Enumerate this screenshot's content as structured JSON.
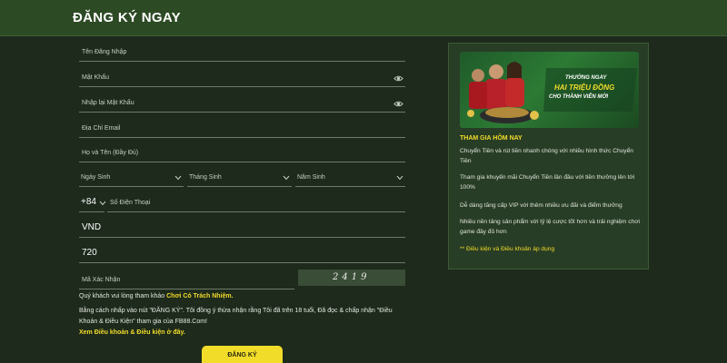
{
  "header": {
    "title": "ĐĂNG KÝ NGAY"
  },
  "form": {
    "username_placeholder": "Tên Đăng Nhập",
    "password_placeholder": "Mật Khẩu",
    "confirm_password_placeholder": "Nhập lại Mật Khẩu",
    "email_placeholder": "Địa Chỉ Email",
    "fullname_placeholder": "Họ và Tên (Đầy Đủ)",
    "birth_day_placeholder": "Ngày Sinh",
    "birth_month_placeholder": "Tháng Sinh",
    "birth_year_placeholder": "Năm Sinh",
    "country_code": "+84",
    "phone_placeholder": "Số Điện Thoại",
    "currency_value": "VND",
    "code_value": "720",
    "captcha_placeholder": "Mã Xác Nhận",
    "captcha_code": "2419",
    "note_prefix": "Quý khách vui lòng tham khảo",
    "note_link": "Chơi Có Trách Nhiệm.",
    "terms_line1": "Bằng cách nhấp vào nút \"ĐĂNG KÝ\". Tôi đồng ý thừa nhận rằng Tôi đã trên 18 tuổi, Đã đọc & chấp nhận \"Điều",
    "terms_line2": "Khoản & Điều Kiện\" tham gia của FB88.Com!",
    "terms_link": "Xem Điều khoản & Điều kiện ở đây.",
    "submit_label": "ĐĂNG KÝ"
  },
  "promo": {
    "banner_line1": "THƯỞNG NGAY",
    "banner_line2": "HAI TRIỆU ĐỒNG",
    "banner_line3": "CHO THÀNH VIÊN MỚI",
    "title": "THAM GIA HÔM NAY",
    "p1": "Chuyển Tiền và rút tiền nhanh chóng với nhiều hình thức Chuyển Tiền",
    "p2": "Tham gia khuyến mãi Chuyển Tiền lần đầu với tiền thưởng lên tới 100%",
    "p3": "Dễ dàng tăng cấp VIP với thêm nhiều ưu đãi và điểm thưởng",
    "p4": "Nhiều nền tảng sản phẩm với tỷ lệ cược tốt hơn và trải nghiệm chơi game đầy đủ hơn",
    "footnote": "** Điều kiện và Điều khoản áp dụng"
  },
  "colors": {
    "background": "#1d2a1c",
    "header": "#2c4a24",
    "accent": "#f2dc2a"
  }
}
